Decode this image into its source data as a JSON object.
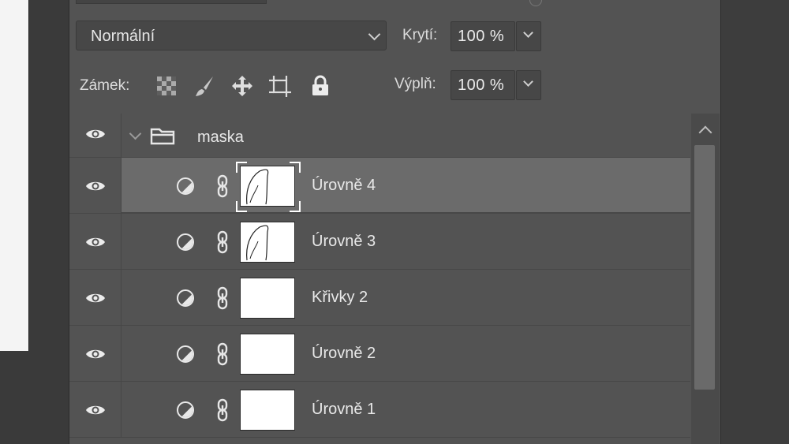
{
  "blend": {
    "mode": "Normální"
  },
  "opacity": {
    "label": "Krytí:",
    "value": "100 %"
  },
  "lock": {
    "label": "Zámek:"
  },
  "fill": {
    "label": "Výplň:",
    "value": "100 %"
  },
  "group": {
    "name": "maska"
  },
  "layers": [
    {
      "name": "Úrovně 4",
      "selected": true,
      "mask_drawn": true
    },
    {
      "name": "Úrovně 3",
      "selected": false,
      "mask_drawn": true
    },
    {
      "name": "Křivky 2",
      "selected": false,
      "mask_drawn": false
    },
    {
      "name": "Úrovně 2",
      "selected": false,
      "mask_drawn": false
    },
    {
      "name": "Úrovně 1",
      "selected": false,
      "mask_drawn": false
    }
  ]
}
